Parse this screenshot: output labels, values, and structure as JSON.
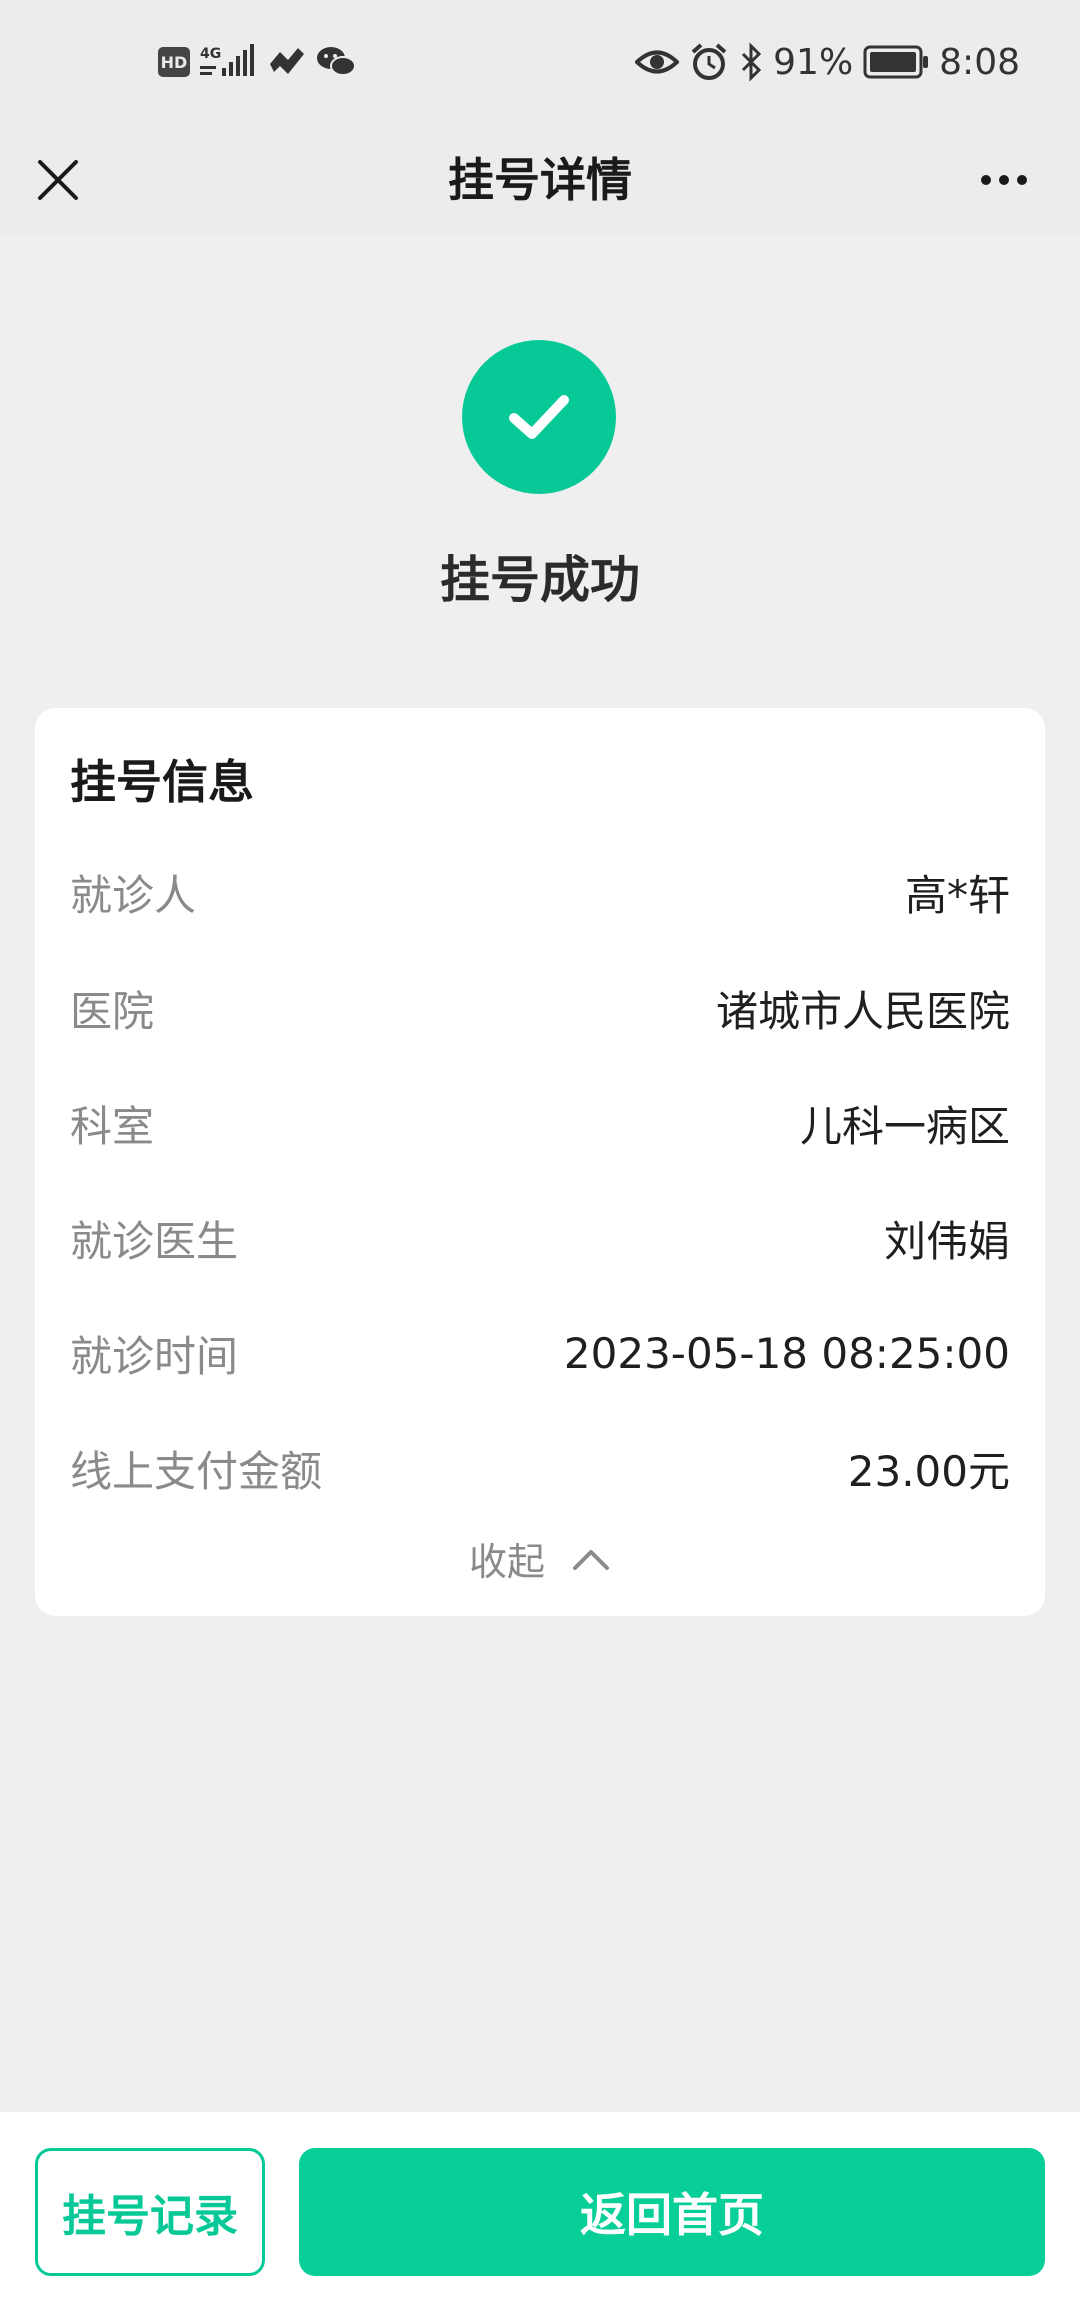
{
  "status_bar": {
    "hd_label": "HD",
    "network_label": "4G",
    "battery_percent": "91%",
    "time": "8:08",
    "icons": [
      "hd-icon",
      "signal-icon",
      "wifi-icon",
      "wechat-icon",
      "eye-icon",
      "alarm-icon",
      "bluetooth-icon",
      "battery-icon"
    ]
  },
  "nav": {
    "title": "挂号详情",
    "close_icon": "close-icon",
    "more_icon": "more-icon"
  },
  "result": {
    "title": "挂号成功",
    "icon": "checkmark-icon",
    "color": "#07c997"
  },
  "card": {
    "title": "挂号信息",
    "rows": [
      {
        "label": "就诊人",
        "value": "高*轩"
      },
      {
        "label": "医院",
        "value": "诸城市人民医院"
      },
      {
        "label": "科室",
        "value": "儿科一病区"
      },
      {
        "label": "就诊医生",
        "value": "刘伟娟"
      },
      {
        "label": "就诊时间",
        "value": "2023-05-18 08:25:00"
      },
      {
        "label": "线上支付金额",
        "value": "23.00元"
      }
    ],
    "collapse_label": "收起"
  },
  "actions": {
    "records_label": "挂号记录",
    "home_label": "返回首页",
    "accent": "#07c997"
  }
}
